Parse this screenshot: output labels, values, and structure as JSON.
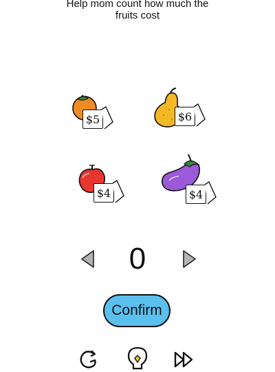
{
  "title": "Help mom count how much the\nfruits cost",
  "items": [
    {
      "name": "orange",
      "price_label": "$5",
      "price": 5,
      "color": "#f08a24"
    },
    {
      "name": "pear",
      "price_label": "$6",
      "price": 6,
      "color": "#f2b826"
    },
    {
      "name": "apple",
      "price_label": "$4",
      "price": 4,
      "color": "#e8352f"
    },
    {
      "name": "eggplant",
      "price_label": "$4",
      "price": 4,
      "color": "#9b5ad9"
    }
  ],
  "counter": {
    "value": "0"
  },
  "confirm_label": "Confirm",
  "colors": {
    "confirm_bg": "#5bc0ee",
    "arrow_fill": "#b3b3b3",
    "hint_bulb": "#f5c518"
  },
  "icons": {
    "left": "triangle-left-icon",
    "right": "triangle-right-icon",
    "restart": "restart-icon",
    "hint": "lightbulb-icon",
    "skip": "fast-forward-icon"
  }
}
